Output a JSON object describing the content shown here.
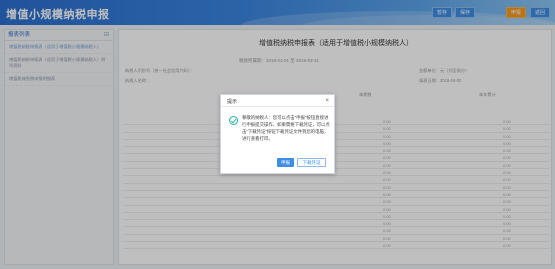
{
  "header": {
    "title": "增值小规模纳税申报",
    "buttons": [
      {
        "label": "暂存",
        "active": false
      },
      {
        "label": "保存",
        "active": false
      },
      {
        "label": "申报",
        "active": true
      },
      {
        "label": "返回",
        "active": false
      }
    ]
  },
  "sidebar": {
    "title": "报表列表",
    "collapse_icon": "collapse-icon",
    "items": [
      "增值税纳税申报表（适用于增值税小规模纳税人）",
      "增值税纳税申报表（适用于增值税小规模纳税人）附列资料",
      "增值税减免税申报明细表"
    ]
  },
  "main": {
    "title": "增值税纳税申报表（适用于增值税小规模纳税人）",
    "period": "税款所属期：2019-01-01 至 2019-03-31",
    "taxpayer_id_label": "纳税人识别号（统一社会信用代码）：",
    "taxpayer_name_label": "纳税人名称：",
    "amount_unit": "金额单位：元（列至角分）",
    "fill_date_label": "填表日期：2019-04-02",
    "current_period": "本期数",
    "ytd": "本年累计"
  },
  "dialog": {
    "title": "提示",
    "close_icon": "close-icon",
    "success_icon": "check-circle-icon",
    "message": "尊敬的纳税人：您可以点击“申报”按钮直接进行申报提交操作，如果需要下载凭证，可以点击“下载凭证”按钮下载凭证文件到您的电脑，进行查看打印。",
    "confirm_label": "申报",
    "download_label": "下载凭证"
  },
  "colors": {
    "primary": "#3e8ee4",
    "accent": "#f59b23",
    "success": "#27b2a0"
  }
}
